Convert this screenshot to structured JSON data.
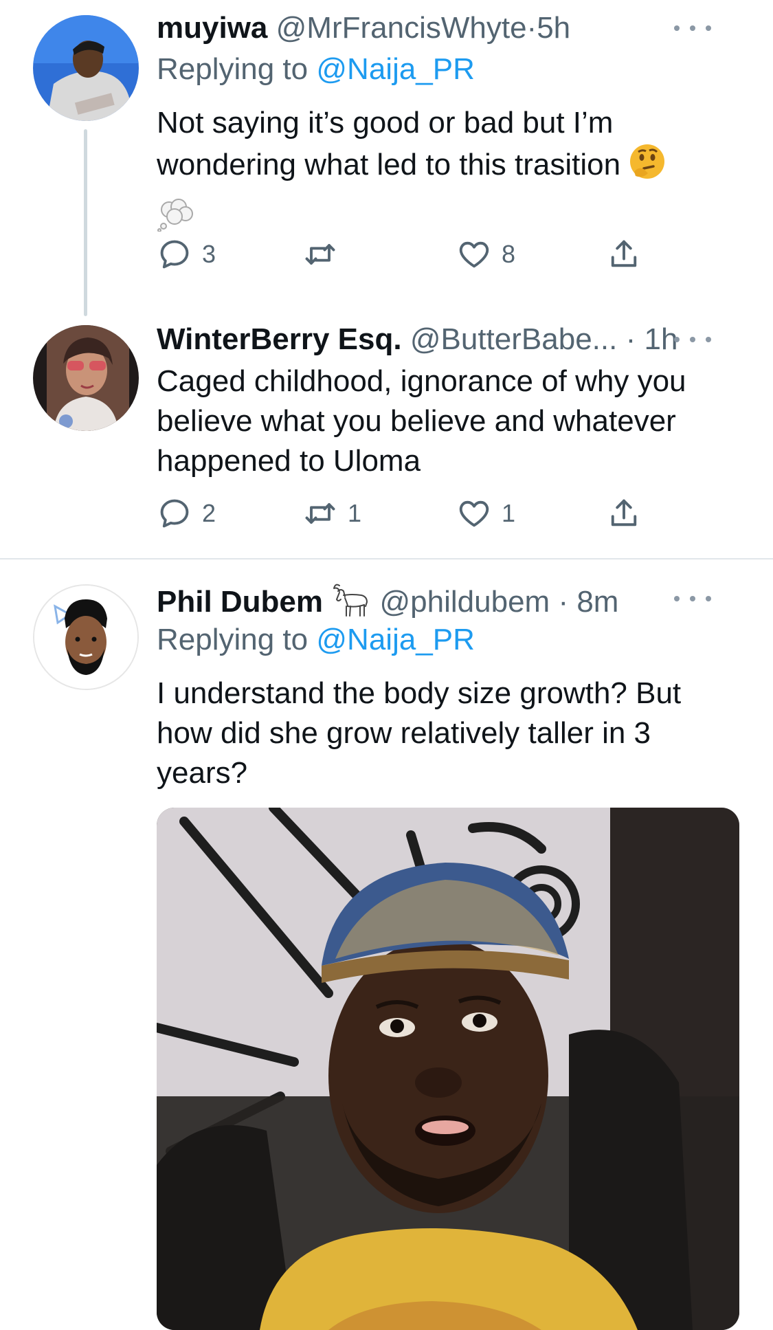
{
  "tweets": [
    {
      "name": "muyiwa",
      "handle": "@MrFrancisWhyte",
      "separator": "·",
      "time": "5h",
      "replying_prefix": "Replying to",
      "replying_to": "@Naija_PR",
      "text": "Not saying it’s good or bad but I’m wondering what led to this trasition",
      "emoji": [
        "thinking-face",
        "thought-balloon"
      ],
      "actions": {
        "replies": "3",
        "retweets": "",
        "likes": "8"
      }
    },
    {
      "name": "WinterBerry Esq.",
      "handle": "@ButterBabe...",
      "separator": "·",
      "time": "1h",
      "text": "Caged childhood, ignorance of why you believe what you believe and whatever happened to Uloma",
      "actions": {
        "replies": "2",
        "retweets": "1",
        "likes": "1"
      }
    },
    {
      "name": "Phil Dubem",
      "name_emoji": "goat",
      "handle": "@phildubem",
      "separator": "·",
      "time": "8m",
      "replying_prefix": "Replying to",
      "replying_to": "@Naija_PR",
      "text": "I understand the body size growth? But how did she grow relatively taller in 3 years?"
    }
  ],
  "colors": {
    "link": "#1d9bf0",
    "secondary_text": "#536471",
    "primary_text": "#0f1419",
    "thread_line": "#cfd9de"
  },
  "icons": [
    "reply-icon",
    "retweet-icon",
    "like-icon",
    "share-icon",
    "more-icon"
  ]
}
